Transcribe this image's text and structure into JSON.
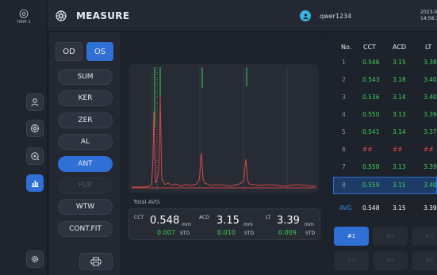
{
  "rail": {
    "logo_text": "HBM-1",
    "buttons": [
      {
        "name": "patient-icon"
      },
      {
        "name": "eye-scan-icon"
      },
      {
        "name": "lens-icon"
      },
      {
        "name": "chart-icon",
        "active": true
      },
      {
        "name": "gear-icon"
      }
    ]
  },
  "header": {
    "title": "MEASURE",
    "username": "qwer1234",
    "date": "2023-0",
    "time": "14:58:1"
  },
  "selector": {
    "od_label": "OD",
    "os_label": "OS",
    "active_eye": "OS",
    "buttons": [
      {
        "label": "SUM"
      },
      {
        "label": "KER"
      },
      {
        "label": "ZER"
      },
      {
        "label": "AL"
      },
      {
        "label": "ANT",
        "active": true
      },
      {
        "label": "PUP",
        "disabled": true
      },
      {
        "label": "WTW"
      },
      {
        "label": "CONT.FIT"
      }
    ]
  },
  "scan": {
    "total_label": "Total AVG",
    "cct": {
      "label": "CCT",
      "value": "0.548",
      "unit": "mm",
      "std": "0.007",
      "std_label": "STD"
    },
    "acd": {
      "label": "ACD",
      "value": "3.15",
      "unit": "mm",
      "std": "0.010",
      "std_label": "STD"
    },
    "lt": {
      "label": "LT",
      "value": "3.39",
      "unit": "mm",
      "std": "0.009",
      "std_label": "STD"
    }
  },
  "table": {
    "headers": [
      "No.",
      "CCT",
      "ACD",
      "LT"
    ],
    "rows": [
      {
        "no": "1",
        "cct": "0.546",
        "acd": "3.15",
        "lt": "3.38"
      },
      {
        "no": "2",
        "cct": "0.543",
        "acd": "3.18",
        "lt": "3.40"
      },
      {
        "no": "3",
        "cct": "0.536",
        "acd": "3.14",
        "lt": "3.40"
      },
      {
        "no": "4",
        "cct": "0.550",
        "acd": "3.13",
        "lt": "3.39"
      },
      {
        "no": "5",
        "cct": "0.541",
        "acd": "3.14",
        "lt": "3.37"
      },
      {
        "no": "6",
        "cct": "##",
        "acd": "##",
        "lt": "##",
        "invalid": true
      },
      {
        "no": "7",
        "cct": "0.558",
        "acd": "3.13",
        "lt": "3.39"
      },
      {
        "no": "8",
        "cct": "0.559",
        "acd": "3.15",
        "lt": "3.40",
        "selected": true
      }
    ],
    "avg": {
      "label": "AVG",
      "cct": "0.548",
      "acd": "3.15",
      "lt": "3.39"
    },
    "tabs": [
      "#1",
      "#2",
      "#3",
      "#4",
      "#5",
      "#6"
    ],
    "active_tab": "#1"
  },
  "colors": {
    "accent": "#2f6fd6",
    "value_green": "#3fd15c",
    "invalid_red": "#e04848",
    "gate_green": "#3fd15c",
    "signal_red": "#d84a4a"
  }
}
